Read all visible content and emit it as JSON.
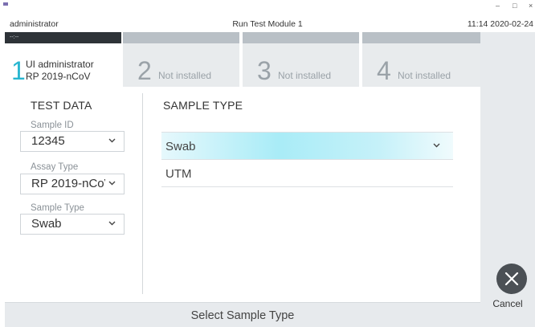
{
  "titlebar": {
    "user": "administrator",
    "title": "Run Test Module 1",
    "datetime": "11:14 2020-02-24",
    "minimize": "–",
    "maximize": "□",
    "close": "×"
  },
  "tabs": [
    {
      "number": "1",
      "line1": "UI administrator",
      "line2": "RP 2019-nCoV",
      "strip_text": "--:--",
      "active": true
    },
    {
      "number": "2",
      "label": "Not installed",
      "active": false
    },
    {
      "number": "3",
      "label": "Not installed",
      "active": false
    },
    {
      "number": "4",
      "label": "Not installed",
      "active": false
    }
  ],
  "test_data": {
    "heading": "TEST DATA",
    "sample_id": {
      "label": "Sample ID",
      "value": "12345"
    },
    "assay_type": {
      "label": "Assay Type",
      "value": "RP 2019-nCoV"
    },
    "sample_type": {
      "label": "Sample Type",
      "value": "Swab"
    }
  },
  "sample_type_panel": {
    "heading": "SAMPLE TYPE",
    "options": [
      {
        "label": "Swab",
        "selected": true
      },
      {
        "label": "UTM",
        "selected": false
      }
    ]
  },
  "cancel": {
    "label": "Cancel",
    "icon": "close-icon"
  },
  "footer": {
    "text": "Select Sample Type"
  },
  "colors": {
    "accent": "#27b6d0",
    "selection": "#a9ecf7",
    "dark": "#4b5055"
  }
}
